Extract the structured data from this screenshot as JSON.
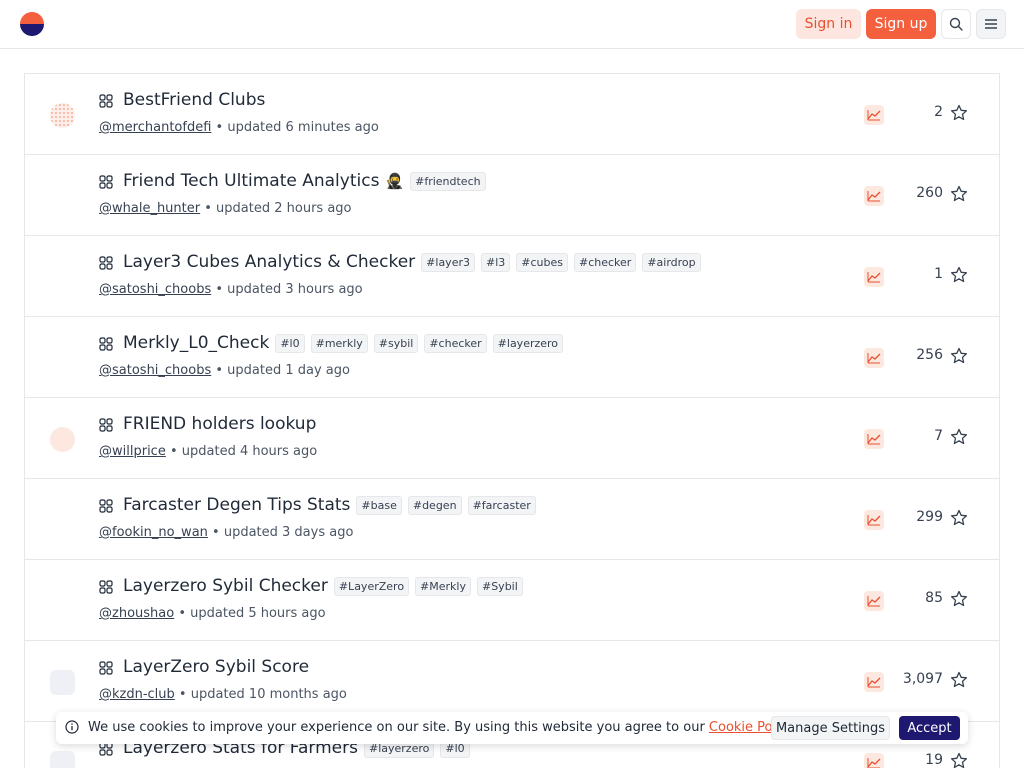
{
  "header": {
    "signin_label": "Sign in",
    "signup_label": "Sign up",
    "brand_colors": {
      "accent": "#f4603e",
      "navy": "#1e1870"
    }
  },
  "rows": [
    {
      "title": "BestFriend Clubs",
      "emoji": "",
      "tags": [],
      "author": "@merchantofdefi",
      "updated": " • updated 6 minutes ago",
      "stars": "2",
      "avatar": "dots"
    },
    {
      "title": "Friend Tech Ultimate Analytics",
      "emoji": "🥷",
      "tags": [
        "#friendtech"
      ],
      "author": "@whale_hunter",
      "updated": " • updated 2 hours ago",
      "stars": "260",
      "avatar": "none"
    },
    {
      "title": "Layer3 Cubes Analytics & Checker",
      "emoji": "",
      "tags": [
        "#layer3",
        "#l3",
        "#cubes",
        "#checker",
        "#airdrop"
      ],
      "author": "@satoshi_choobs",
      "updated": " • updated 3 hours ago",
      "stars": "1",
      "avatar": "none"
    },
    {
      "title": "Merkly_L0_Check",
      "emoji": "",
      "tags": [
        "#l0",
        "#merkly",
        "#sybil",
        "#checker",
        "#layerzero"
      ],
      "author": "@satoshi_choobs",
      "updated": " • updated 1 day ago",
      "stars": "256",
      "avatar": "none"
    },
    {
      "title": "FRIEND holders lookup",
      "emoji": "",
      "tags": [],
      "author": "@willprice",
      "updated": " • updated 4 hours ago",
      "stars": "7",
      "avatar": "soft"
    },
    {
      "title": "Farcaster Degen Tips Stats",
      "emoji": "",
      "tags": [
        "#base",
        "#degen",
        "#farcaster"
      ],
      "author": "@fookin_no_wan",
      "updated": " • updated 3 days ago",
      "stars": "299",
      "avatar": "none"
    },
    {
      "title": "Layerzero Sybil Checker",
      "emoji": "",
      "tags": [
        "#LayerZero",
        "#Merkly",
        "#Sybil"
      ],
      "author": "@zhoushao",
      "updated": " • updated 5 hours ago",
      "stars": "85",
      "avatar": "none"
    },
    {
      "title": "LayerZero Sybil Score",
      "emoji": "",
      "tags": [],
      "author": "@kzdn-club",
      "updated": " • updated 10 months ago",
      "stars": "3,097",
      "avatar": "gray"
    },
    {
      "title": "Layerzero Stats for Farmers",
      "emoji": "",
      "tags": [
        "#layerzero",
        "#l0"
      ],
      "author": "",
      "updated": "",
      "stars": "19",
      "avatar": "gray"
    }
  ],
  "cookie": {
    "text": "We use cookies to improve your experience on our site. By using this website you agree to our ",
    "link": "Cookie Policy",
    "period": ".",
    "manage_label": "Manage Settings",
    "accept_label": "Accept"
  }
}
